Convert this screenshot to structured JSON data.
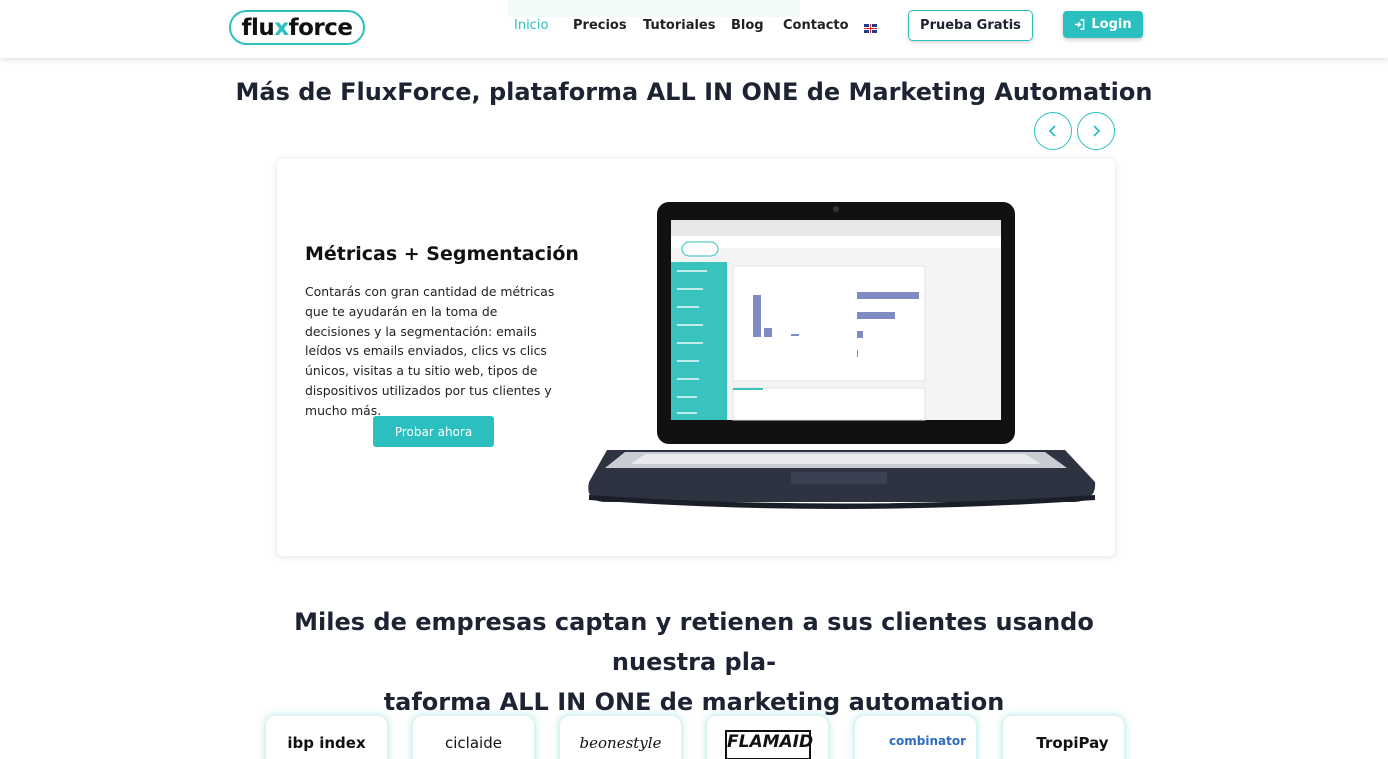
{
  "brand": {
    "logo_pre": "flu",
    "logo_x": "x",
    "logo_post": "force",
    "accent_color": "#2bbfbf"
  },
  "nav": {
    "items": [
      {
        "label": "Inicio",
        "active": true
      },
      {
        "label": "Precios"
      },
      {
        "label": "Tutoriales"
      },
      {
        "label": "Blog"
      },
      {
        "label": "Contacto"
      }
    ],
    "language_flag": "uk-flag-icon",
    "trial_label": "Prueba Gratis",
    "login_label": "Login"
  },
  "section": {
    "title": "Más de FluxForce, plataforma ALL IN ONE de Marketing Automation",
    "prev_icon": "chevron-left-icon",
    "next_icon": "chevron-right-icon"
  },
  "feature": {
    "title": "Métricas + Segmentación",
    "description": "Contarás con gran cantidad de métricas que te ayudarán en la toma de decisiones y la segmentación: emails leídos vs emails enviados, clics vs clics únicos, visitas a tu sitio web, tipos de dispositivos utilizados por tus clientes y mucho más.",
    "cta_label": "Probar ahora"
  },
  "clients": {
    "title": "Miles de empresas captan y retienen a sus clientes usando nuestra plataforma ALL IN ONE de marketing automation",
    "title_line1": "Miles de empresas captan y retienen a sus clientes usando nuestra pla-",
    "title_line2": "taforma ALL IN ONE de marketing automation",
    "logos": [
      {
        "name": "ibp index"
      },
      {
        "name": "ciclaide"
      },
      {
        "name": "beonestyle"
      },
      {
        "name": "FLAMAID"
      },
      {
        "name": "combinator"
      },
      {
        "name": "TropiPay"
      }
    ]
  }
}
